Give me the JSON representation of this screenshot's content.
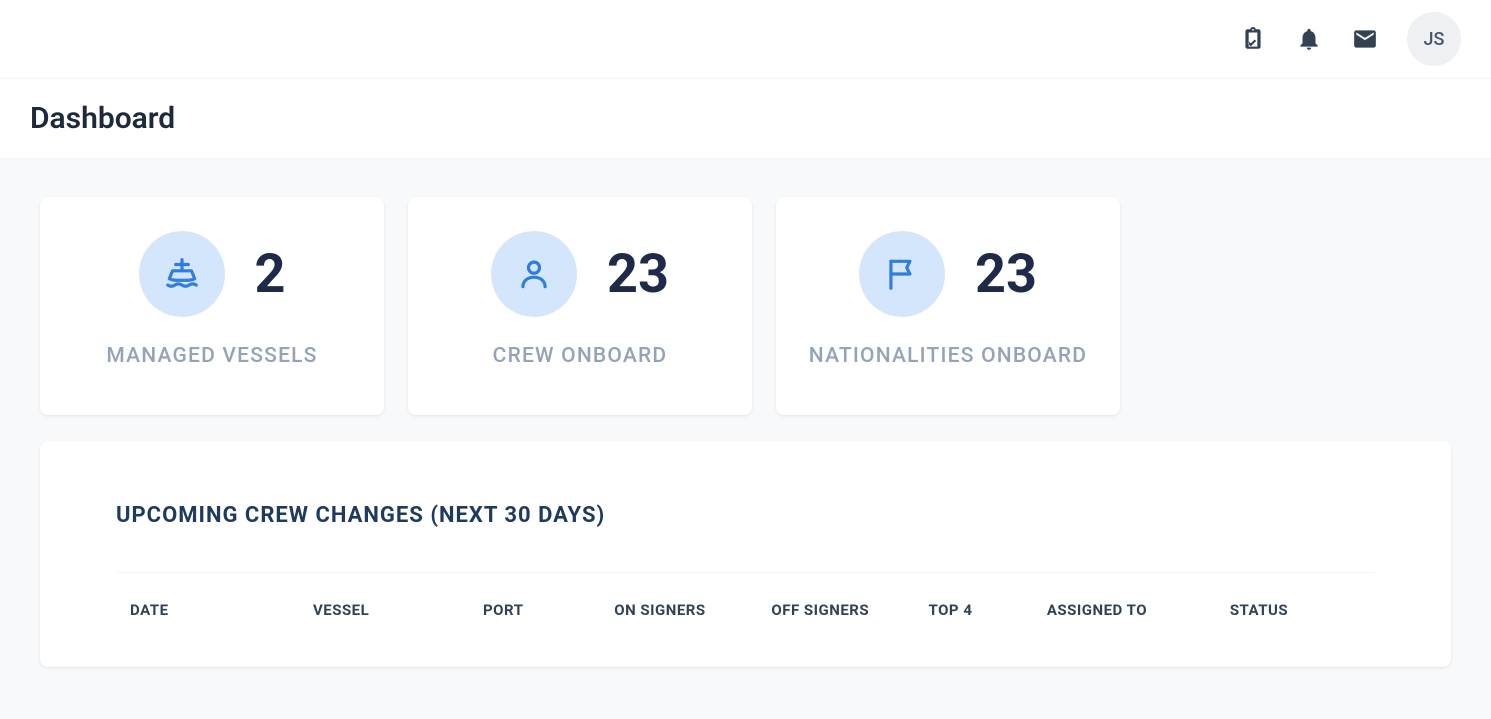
{
  "header": {
    "avatar_initials": "JS"
  },
  "page": {
    "title": "Dashboard"
  },
  "stats": [
    {
      "value": "2",
      "label": "MANAGED VESSELS",
      "icon": "ship"
    },
    {
      "value": "23",
      "label": "CREW ONBOARD",
      "icon": "person"
    },
    {
      "value": "23",
      "label": "NATIONALITIES ONBOARD",
      "icon": "flag"
    }
  ],
  "upcoming": {
    "title": "UPCOMING CREW CHANGES (NEXT 30 DAYS)",
    "columns": [
      "DATE",
      "VESSEL",
      "PORT",
      "ON SIGNERS",
      "OFF SIGNERS",
      "TOP 4",
      "ASSIGNED TO",
      "STATUS"
    ]
  }
}
